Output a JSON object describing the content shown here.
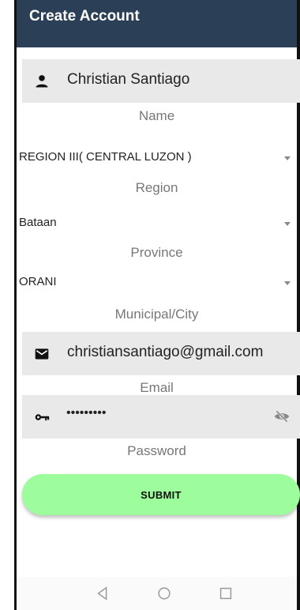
{
  "appbar": {
    "title": "Create Account"
  },
  "name_field": {
    "value": "Christian Santiago",
    "caption": "Name",
    "icon": "person-icon"
  },
  "region": {
    "value": "REGION III( CENTRAL LUZON )",
    "caption": "Region"
  },
  "province": {
    "value": "Bataan",
    "caption": "Province"
  },
  "municipality": {
    "value": "ORANI",
    "caption": "Municipal/City"
  },
  "email_field": {
    "value": "christiansantiago@gmail.com",
    "caption": "Email",
    "icon": "mail-icon"
  },
  "password_field": {
    "value": "•••••••••",
    "caption": "Password",
    "icon": "key-icon",
    "toggle_icon": "eye-off-icon"
  },
  "submit": {
    "label": "SUBMIT",
    "color": "#9dfc9b"
  },
  "colors": {
    "appbar": "#2b3f56",
    "field_bg": "#e9e9e9",
    "caption": "#777777"
  },
  "navbar": {
    "icons": [
      "back-icon",
      "home-icon",
      "recents-icon"
    ]
  }
}
